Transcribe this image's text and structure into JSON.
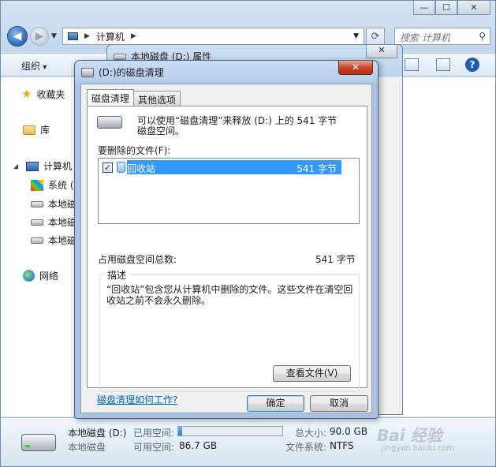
{
  "explorer": {
    "address": {
      "part1": "计算机"
    },
    "search_placeholder": "搜索 计算机",
    "toolbar": {
      "organize": "组织"
    },
    "window_controls": {
      "minimize": "—",
      "maximize": "☐",
      "close": "✕"
    },
    "nav": {
      "favorites": "收藏夹",
      "libraries": "库",
      "computer": "计算机",
      "drives": [
        "系统 (",
        "本地磁",
        "本地磁",
        "本地磁"
      ],
      "network": "网络"
    },
    "status": {
      "drive_name": "本地磁盘 (D:)",
      "drive_type": "本地磁盘",
      "used_label": "已用空间:",
      "free_label": "可用空间:",
      "free_value": "86.7 GB",
      "total_label": "总大小:",
      "total_value": "90.0 GB",
      "fs_label": "文件系统:",
      "fs_value": "NTFS",
      "used_fraction": 0.037
    }
  },
  "properties_window": {
    "title": "本地磁盘 (D:) 属性",
    "close": "✕"
  },
  "dialog": {
    "title": "(D:)的磁盘清理",
    "close": "✕",
    "tabs": [
      "磁盘清理",
      "其他选项"
    ],
    "intro_line1": "可以使用“磁盘清理”来释放  (D:) 上的 541 字节",
    "intro_line2": "磁盘空间。",
    "files_label": "要删除的文件(F):",
    "files": [
      {
        "name": "回收站",
        "size": "541 字节",
        "checked": "✓"
      }
    ],
    "total_label": "占用磁盘空间总数:",
    "total_value": "541 字节",
    "description_legend": "描述",
    "description": "“回收站”包含您从计算机中删除的文件。这些文件在清空回收站之前不会永久删除。",
    "view_files_button": "查看文件(V)",
    "help_link": "磁盘清理如何工作?",
    "ok_button": "确定",
    "cancel_button": "取消"
  },
  "watermark": {
    "main": "Bai 经验",
    "sub": "jingyan.baidu.com"
  }
}
